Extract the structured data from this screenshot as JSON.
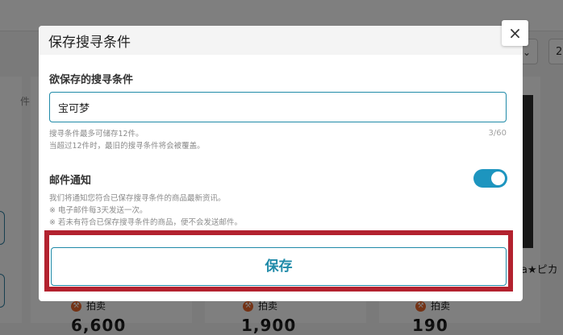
{
  "background": {
    "sort_select_value": "",
    "page_select_value": "2",
    "sidebar_fragment": "件",
    "card_title_fragment": "a★ピカ",
    "auction_label": "拍卖",
    "auction_icon": "hammer-icon",
    "prices": [
      "6,600",
      "1,900",
      "190"
    ]
  },
  "modal": {
    "title": "保存搜寻条件",
    "close_icon": "×",
    "search_label": "欲保存的搜寻条件",
    "search_value": "宝可梦",
    "search_hint_1": "搜寻条件最多可储存12件。",
    "search_hint_2": "当超过12件时，最旧的搜寻条件将会被覆盖。",
    "char_count": "3/60",
    "email_label": "邮件通知",
    "email_enabled": true,
    "email_note_1": "我们将通知您符合已保存搜寻条件的商品最新资讯。",
    "email_note_2": "※ 电子邮件每3天发送一次。",
    "email_note_3": "※ 若未有符合已保存搜寻条件的商品，便不会发送邮件。",
    "save_label": "保存"
  },
  "colors": {
    "accent": "#1f8aa8",
    "toggle_on": "#1d95bf",
    "highlight": "#b3222f",
    "auction_icon": "#e9672c"
  }
}
